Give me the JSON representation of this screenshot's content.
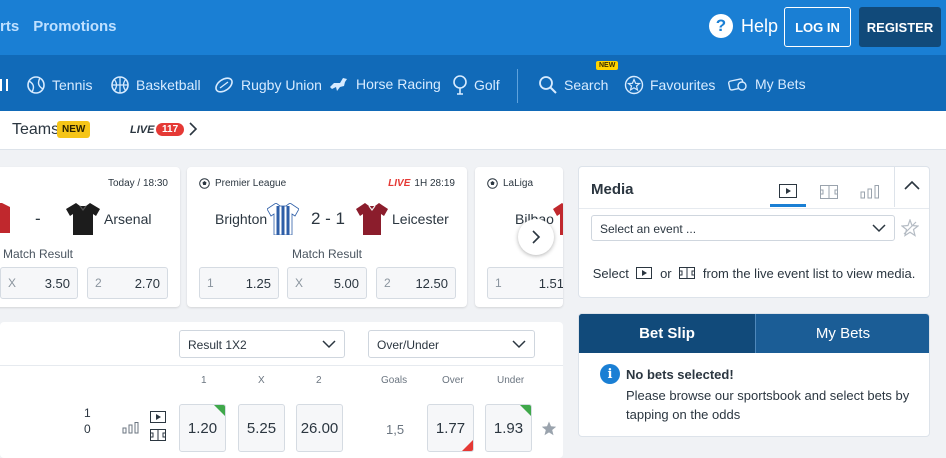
{
  "topbar": {
    "nav": [
      "rts",
      "Promotions"
    ],
    "help_label": "Help",
    "login_label": "LOG IN",
    "register_label": "REGISTER"
  },
  "sports_nav": {
    "items": [
      {
        "label": "Tennis",
        "icon": "tennis-ball-icon"
      },
      {
        "label": "Basketball",
        "icon": "basketball-icon"
      },
      {
        "label": "Rugby Union",
        "icon": "rugby-ball-icon"
      },
      {
        "label": "Horse Racing",
        "icon": "horse-icon"
      },
      {
        "label": "Golf",
        "icon": "golf-icon"
      },
      {
        "label": "Search",
        "icon": "search-icon"
      },
      {
        "label": "Favourites",
        "icon": "star-icon"
      },
      {
        "label": "My Bets",
        "icon": "my-bets-icon"
      }
    ],
    "search_new_tag": "NEW"
  },
  "filter_row": {
    "teams_label": "Teams",
    "teams_badge": "NEW",
    "live_label": "LIVE",
    "live_count": "117"
  },
  "cards": [
    {
      "time": "Today / 18:30",
      "home": "",
      "score_sep": "-",
      "away": "Arsenal",
      "market": "Match Result",
      "odds": [
        {
          "label": "X",
          "value": "3.50"
        },
        {
          "label": "2",
          "value": "2.70"
        }
      ]
    },
    {
      "league": "Premier League",
      "live_label": "LIVE",
      "time": "1H 28:19",
      "home": "Brighton",
      "score": "2 - 1",
      "away": "Leicester",
      "market": "Match Result",
      "odds": [
        {
          "label": "1",
          "value": "1.25"
        },
        {
          "label": "X",
          "value": "5.00"
        },
        {
          "label": "2",
          "value": "12.50"
        }
      ]
    },
    {
      "league": "LaLiga",
      "home": "Bilbao",
      "odds": [
        {
          "label": "1",
          "value": "1.51"
        }
      ]
    }
  ],
  "market_table": {
    "select_result": "Result 1X2",
    "select_over_under": "Over/Under",
    "headers": [
      "1",
      "X",
      "2",
      "Goals",
      "Over",
      "Under"
    ],
    "row": {
      "score_home": "1",
      "score_away": "0",
      "odds_1": "1.20",
      "odds_x": "5.25",
      "odds_2": "26.00",
      "goals": "1,5",
      "over": "1.77",
      "under": "1.93"
    }
  },
  "media": {
    "title": "Media",
    "select_placeholder": "Select an event ...",
    "hint_select": "Select",
    "hint_or": "or",
    "hint_rest": "from the live event list to view media."
  },
  "betslip": {
    "tab_betslip": "Bet Slip",
    "tab_mybets": "My Bets",
    "no_bets_title": "No bets selected!",
    "no_bets_text": "Please browse our sportsbook and select bets by tapping on the odds"
  },
  "colors": {
    "topbar": "#1a7fd4",
    "sportsnav": "#116ab8",
    "register_bg": "#114a7a",
    "live_red": "#e53935",
    "up_green": "#3fa84a"
  }
}
